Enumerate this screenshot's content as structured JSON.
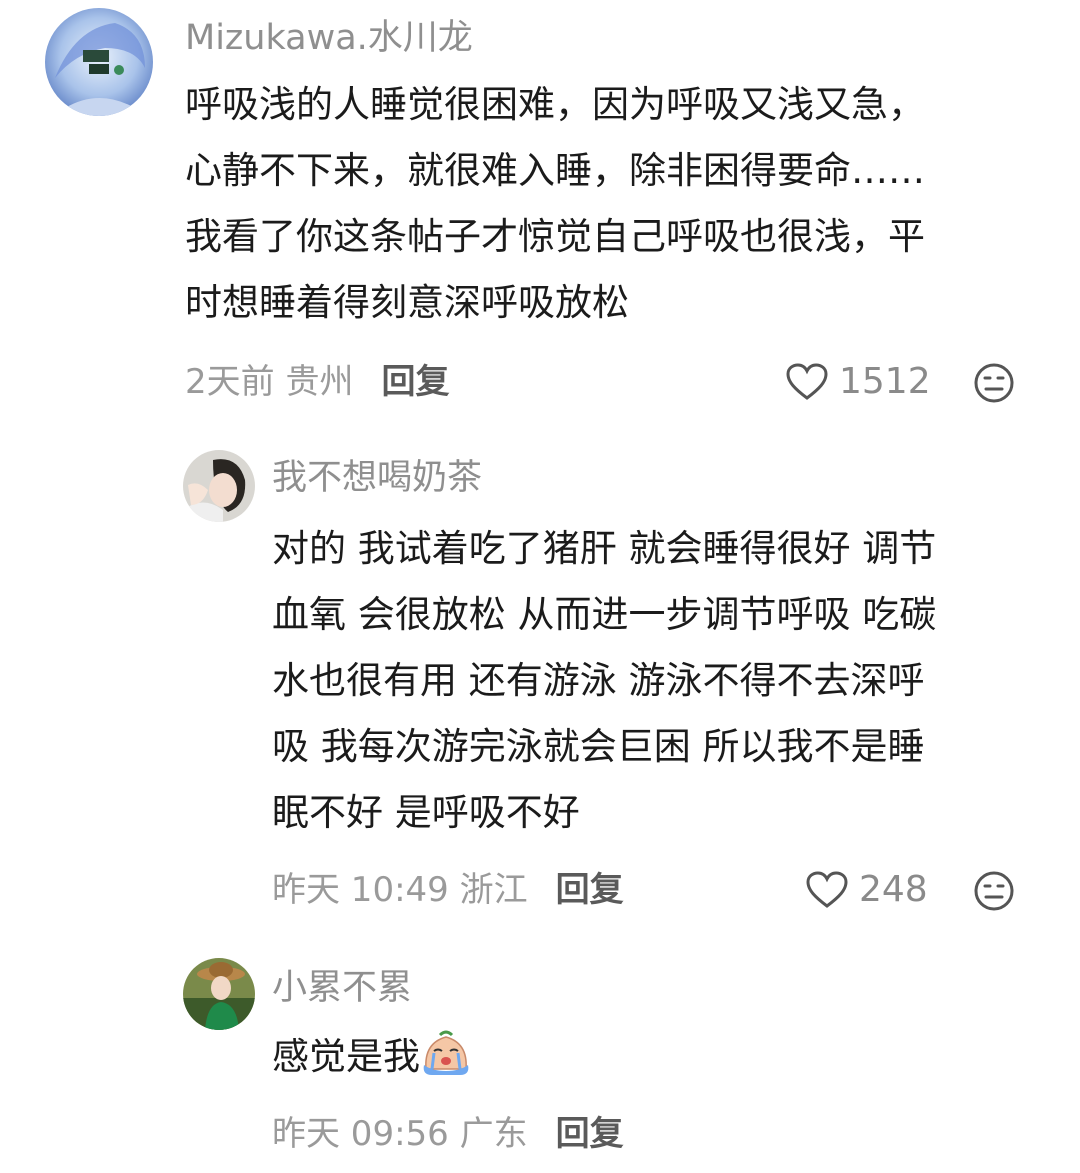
{
  "comments": [
    {
      "username": "Mizukawa.水川龙",
      "lines": [
        "呼吸浅的人睡觉很困难，因为呼吸又浅又急，",
        "心静不下来，就很难入睡，除非困得要命……",
        "我看了你这条帖子才惊觉自己呼吸也很浅，平",
        "时想睡着得刻意深呼吸放松"
      ],
      "time_location": "2天前 贵州",
      "reply_label": "回复",
      "likes": "1512"
    },
    {
      "username": "我不想喝奶茶",
      "lines": [
        "对的 我试着吃了猪肝 就会睡得很好 调节",
        "血氧 会很放松 从而进一步调节呼吸 吃碳",
        "水也很有用 还有游泳 游泳不得不去深呼",
        "吸 我每次游完泳就会巨困 所以我不是睡",
        "眠不好 是呼吸不好"
      ],
      "time_location": "昨天 10:49 浙江",
      "reply_label": "回复",
      "likes": "248"
    },
    {
      "username": "小累不累",
      "lines": [
        "感觉是我"
      ],
      "emoji": "crying-emoji",
      "time_location": "昨天 09:56 广东",
      "reply_label": "回复"
    }
  ],
  "icons": {
    "like": "heart-outline-icon",
    "dislike": "meh-face-icon"
  },
  "colors": {
    "username": "#8f8f8f",
    "body": "#1b1b1b",
    "meta": "#9a9a9a",
    "reply": "#5a5a5a"
  }
}
